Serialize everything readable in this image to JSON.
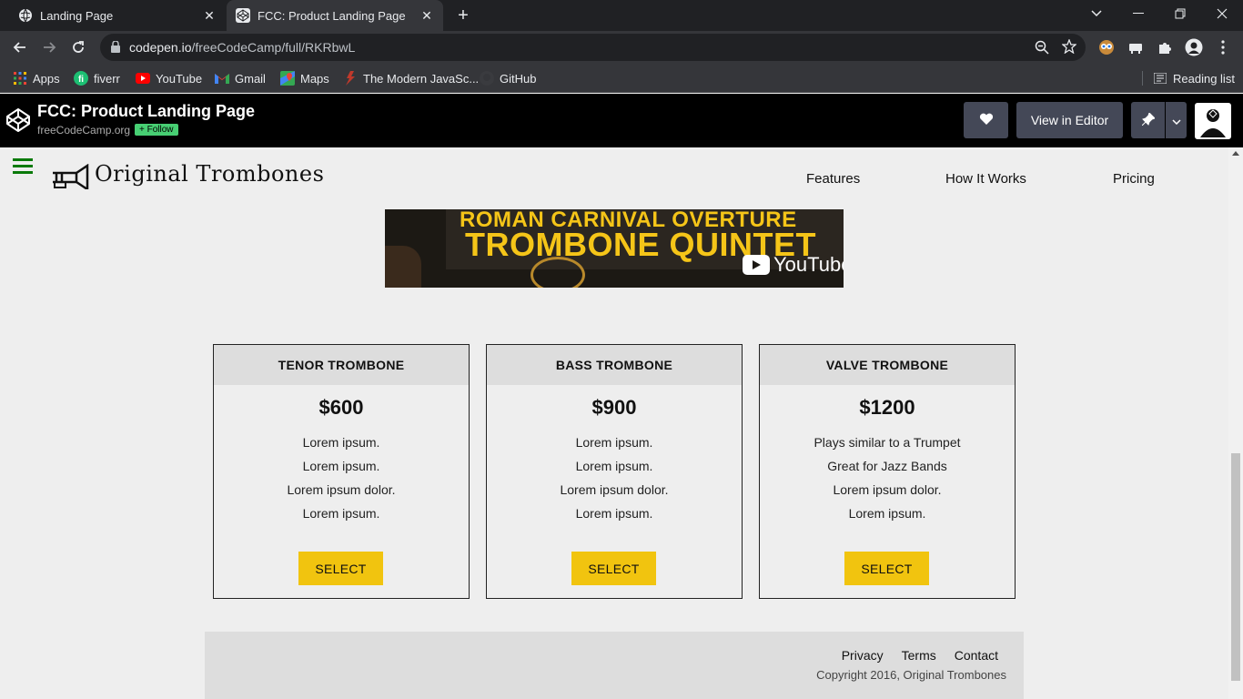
{
  "browser": {
    "tabs": [
      {
        "title": "Landing Page"
      },
      {
        "title": "FCC: Product Landing Page"
      }
    ],
    "url_host": "codepen.io",
    "url_path": "/freeCodeCamp/full/RKRbwL",
    "bookmarks": [
      {
        "label": "Apps",
        "icon": "apps-grid-icon"
      },
      {
        "label": "fiverr",
        "icon": "fiverr-icon"
      },
      {
        "label": "YouTube",
        "icon": "youtube-icon"
      },
      {
        "label": "Gmail",
        "icon": "gmail-icon"
      },
      {
        "label": "Maps",
        "icon": "maps-icon"
      },
      {
        "label": "The Modern JavaSc...",
        "icon": "js-info-icon"
      },
      {
        "label": "GitHub",
        "icon": "github-icon"
      }
    ],
    "reading_list": "Reading list"
  },
  "codepen": {
    "title": "FCC: Product Landing Page",
    "user": "freeCodeCamp.org",
    "follow": "+ Follow",
    "view_in_editor": "View in Editor"
  },
  "site": {
    "brand": "Original Trombones",
    "nav": [
      "Features",
      "How It Works",
      "Pricing"
    ],
    "video": {
      "line1": "ROMAN CARNIVAL OVERTURE",
      "line2": "TROMBONE QUINTET",
      "yt": "YouTube"
    },
    "cards": [
      {
        "name": "TENOR TROMBONE",
        "price": "$600",
        "features": [
          "Lorem ipsum.",
          "Lorem ipsum.",
          "Lorem ipsum dolor.",
          "Lorem ipsum."
        ],
        "button": "SELECT"
      },
      {
        "name": "BASS TROMBONE",
        "price": "$900",
        "features": [
          "Lorem ipsum.",
          "Lorem ipsum.",
          "Lorem ipsum dolor.",
          "Lorem ipsum."
        ],
        "button": "SELECT"
      },
      {
        "name": "VALVE TROMBONE",
        "price": "$1200",
        "features": [
          "Plays similar to a Trumpet",
          "Great for Jazz Bands",
          "Lorem ipsum dolor.",
          "Lorem ipsum."
        ],
        "button": "SELECT"
      }
    ],
    "footer": {
      "links": [
        "Privacy",
        "Terms",
        "Contact"
      ],
      "copyright": "Copyright 2016, Original Trombones"
    }
  },
  "colors": {
    "accent_button": "#f1c40f",
    "hamburger": "#0a7a0a",
    "follow_green": "#47cf73"
  }
}
